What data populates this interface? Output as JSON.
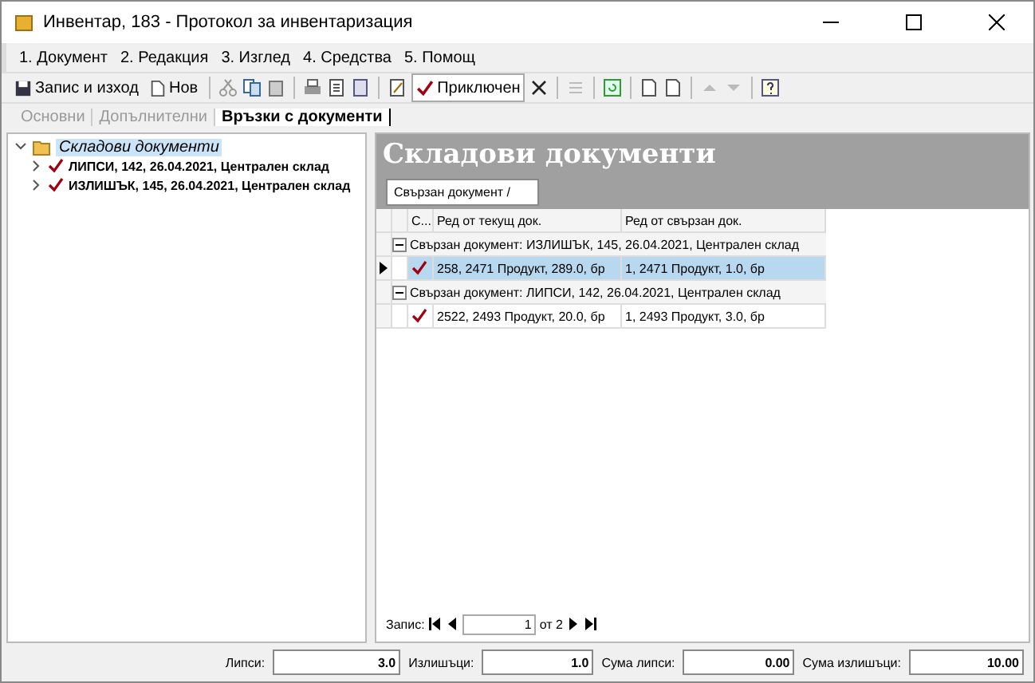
{
  "window": {
    "title": "Инвентар, 183 - Протокол за инвентаризация"
  },
  "menu": [
    "1. Документ",
    "2. Редакция",
    "3. Изглед",
    "4. Средства",
    "5. Помощ"
  ],
  "toolbar": {
    "save": "Запис и изход",
    "new": "Нов",
    "closed": {
      "label": "Приключен",
      "checked": true
    }
  },
  "tabs": [
    {
      "label": "Основни",
      "selected": false
    },
    {
      "label": "Допълнителни",
      "selected": false
    },
    {
      "label": "Връзки с документи",
      "selected": true
    }
  ],
  "tree": {
    "label": "Складови документи",
    "expanded": true,
    "selected": true,
    "children": [
      {
        "label": "ЛИПСИ, 142, 26.04.2021, Централен склад",
        "checked": true,
        "expanded": false,
        "selected": false
      },
      {
        "label": "ИЗЛИШЪК, 145, 26.04.2021, Централен склад",
        "checked": true,
        "expanded": false,
        "selected": false
      }
    ]
  },
  "panel": {
    "title": "Складови документи",
    "group_chip": "Свързан документ /",
    "columns": [
      "С...",
      "Ред от текущ док.",
      "Ред от свързан док."
    ],
    "groups": [
      {
        "label": "Свързан документ: ИЗЛИШЪК, 145, 26.04.2021, Централен склад",
        "expanded": true,
        "rows": [
          {
            "checked": true,
            "selected": true,
            "cells": [
              "258, 2471 Продукт, 289.0, бр",
              "1, 2471 Продукт, 1.0, бр"
            ]
          }
        ]
      },
      {
        "label": "Свързан документ: ЛИПСИ, 142, 26.04.2021, Централен склад",
        "expanded": true,
        "rows": [
          {
            "checked": true,
            "selected": false,
            "cells": [
              "2522, 2493 Продукт, 20.0, бр",
              "1, 2493 Продукт, 3.0, бр"
            ]
          }
        ]
      }
    ]
  },
  "navigator": {
    "label": "Запис:",
    "value": "1",
    "total": "от 2"
  },
  "totals": [
    {
      "label": "Липси:",
      "value": "3.0"
    },
    {
      "label": "Излишъци:",
      "value": "1.0"
    },
    {
      "label": "Сума липси:",
      "value": "0.00"
    },
    {
      "label": "Сума излишъци:",
      "value": "10.00"
    }
  ]
}
